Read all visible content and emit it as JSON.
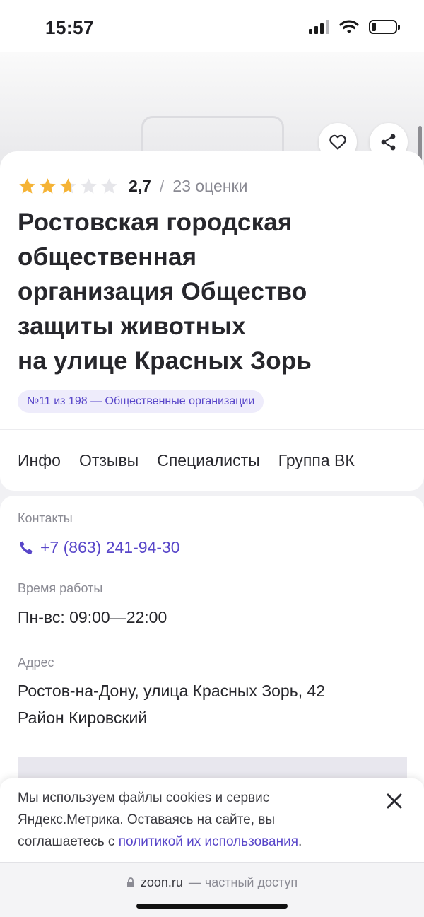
{
  "status_bar": {
    "time": "15:57",
    "battery_level": 0.2
  },
  "header": {
    "favorite_icon": "heart-icon",
    "share_icon": "share-icon",
    "photo_icon": "image-placeholder-icon"
  },
  "org": {
    "rating": {
      "stars_filled": 2.7,
      "stars_total": 5,
      "value": "2,7",
      "separator": "/",
      "count": "23 оценки",
      "star_color": "#f5b335",
      "star_empty_color": "#e6e6ea"
    },
    "title_lines": [
      "Ростовская городская",
      "общественная",
      "организация Общество",
      "защиты животных",
      "на улице Красных Зорь"
    ],
    "rank_badge": "№11 из 198 — Общественные организации"
  },
  "tabs": [
    {
      "label": "Инфо"
    },
    {
      "label": "Отзывы"
    },
    {
      "label": "Специалисты"
    },
    {
      "label": "Группа ВК"
    }
  ],
  "info": {
    "contacts_label": "Контакты",
    "phone": "+7 (863) 241-94-30",
    "hours_label": "Время работы",
    "hours": "Пн-вс: 09:00—22:00",
    "address_label": "Адрес",
    "address_line1": "Ростов-на-Дону, улица Красных Зорь, 42",
    "address_line2": "Район Кировский",
    "accent_color": "#5846c9"
  },
  "cookie": {
    "text": "Мы используем файлы cookies и сервис Яндекс.Метрика. Оставаясь на сайте, вы соглашаетесь с ",
    "link": "политикой их использования",
    "end": ".",
    "close_icon": "close-icon"
  },
  "browser": {
    "domain": "zoon.ru",
    "note": "— частный доступ",
    "lock_icon": "lock-icon"
  }
}
